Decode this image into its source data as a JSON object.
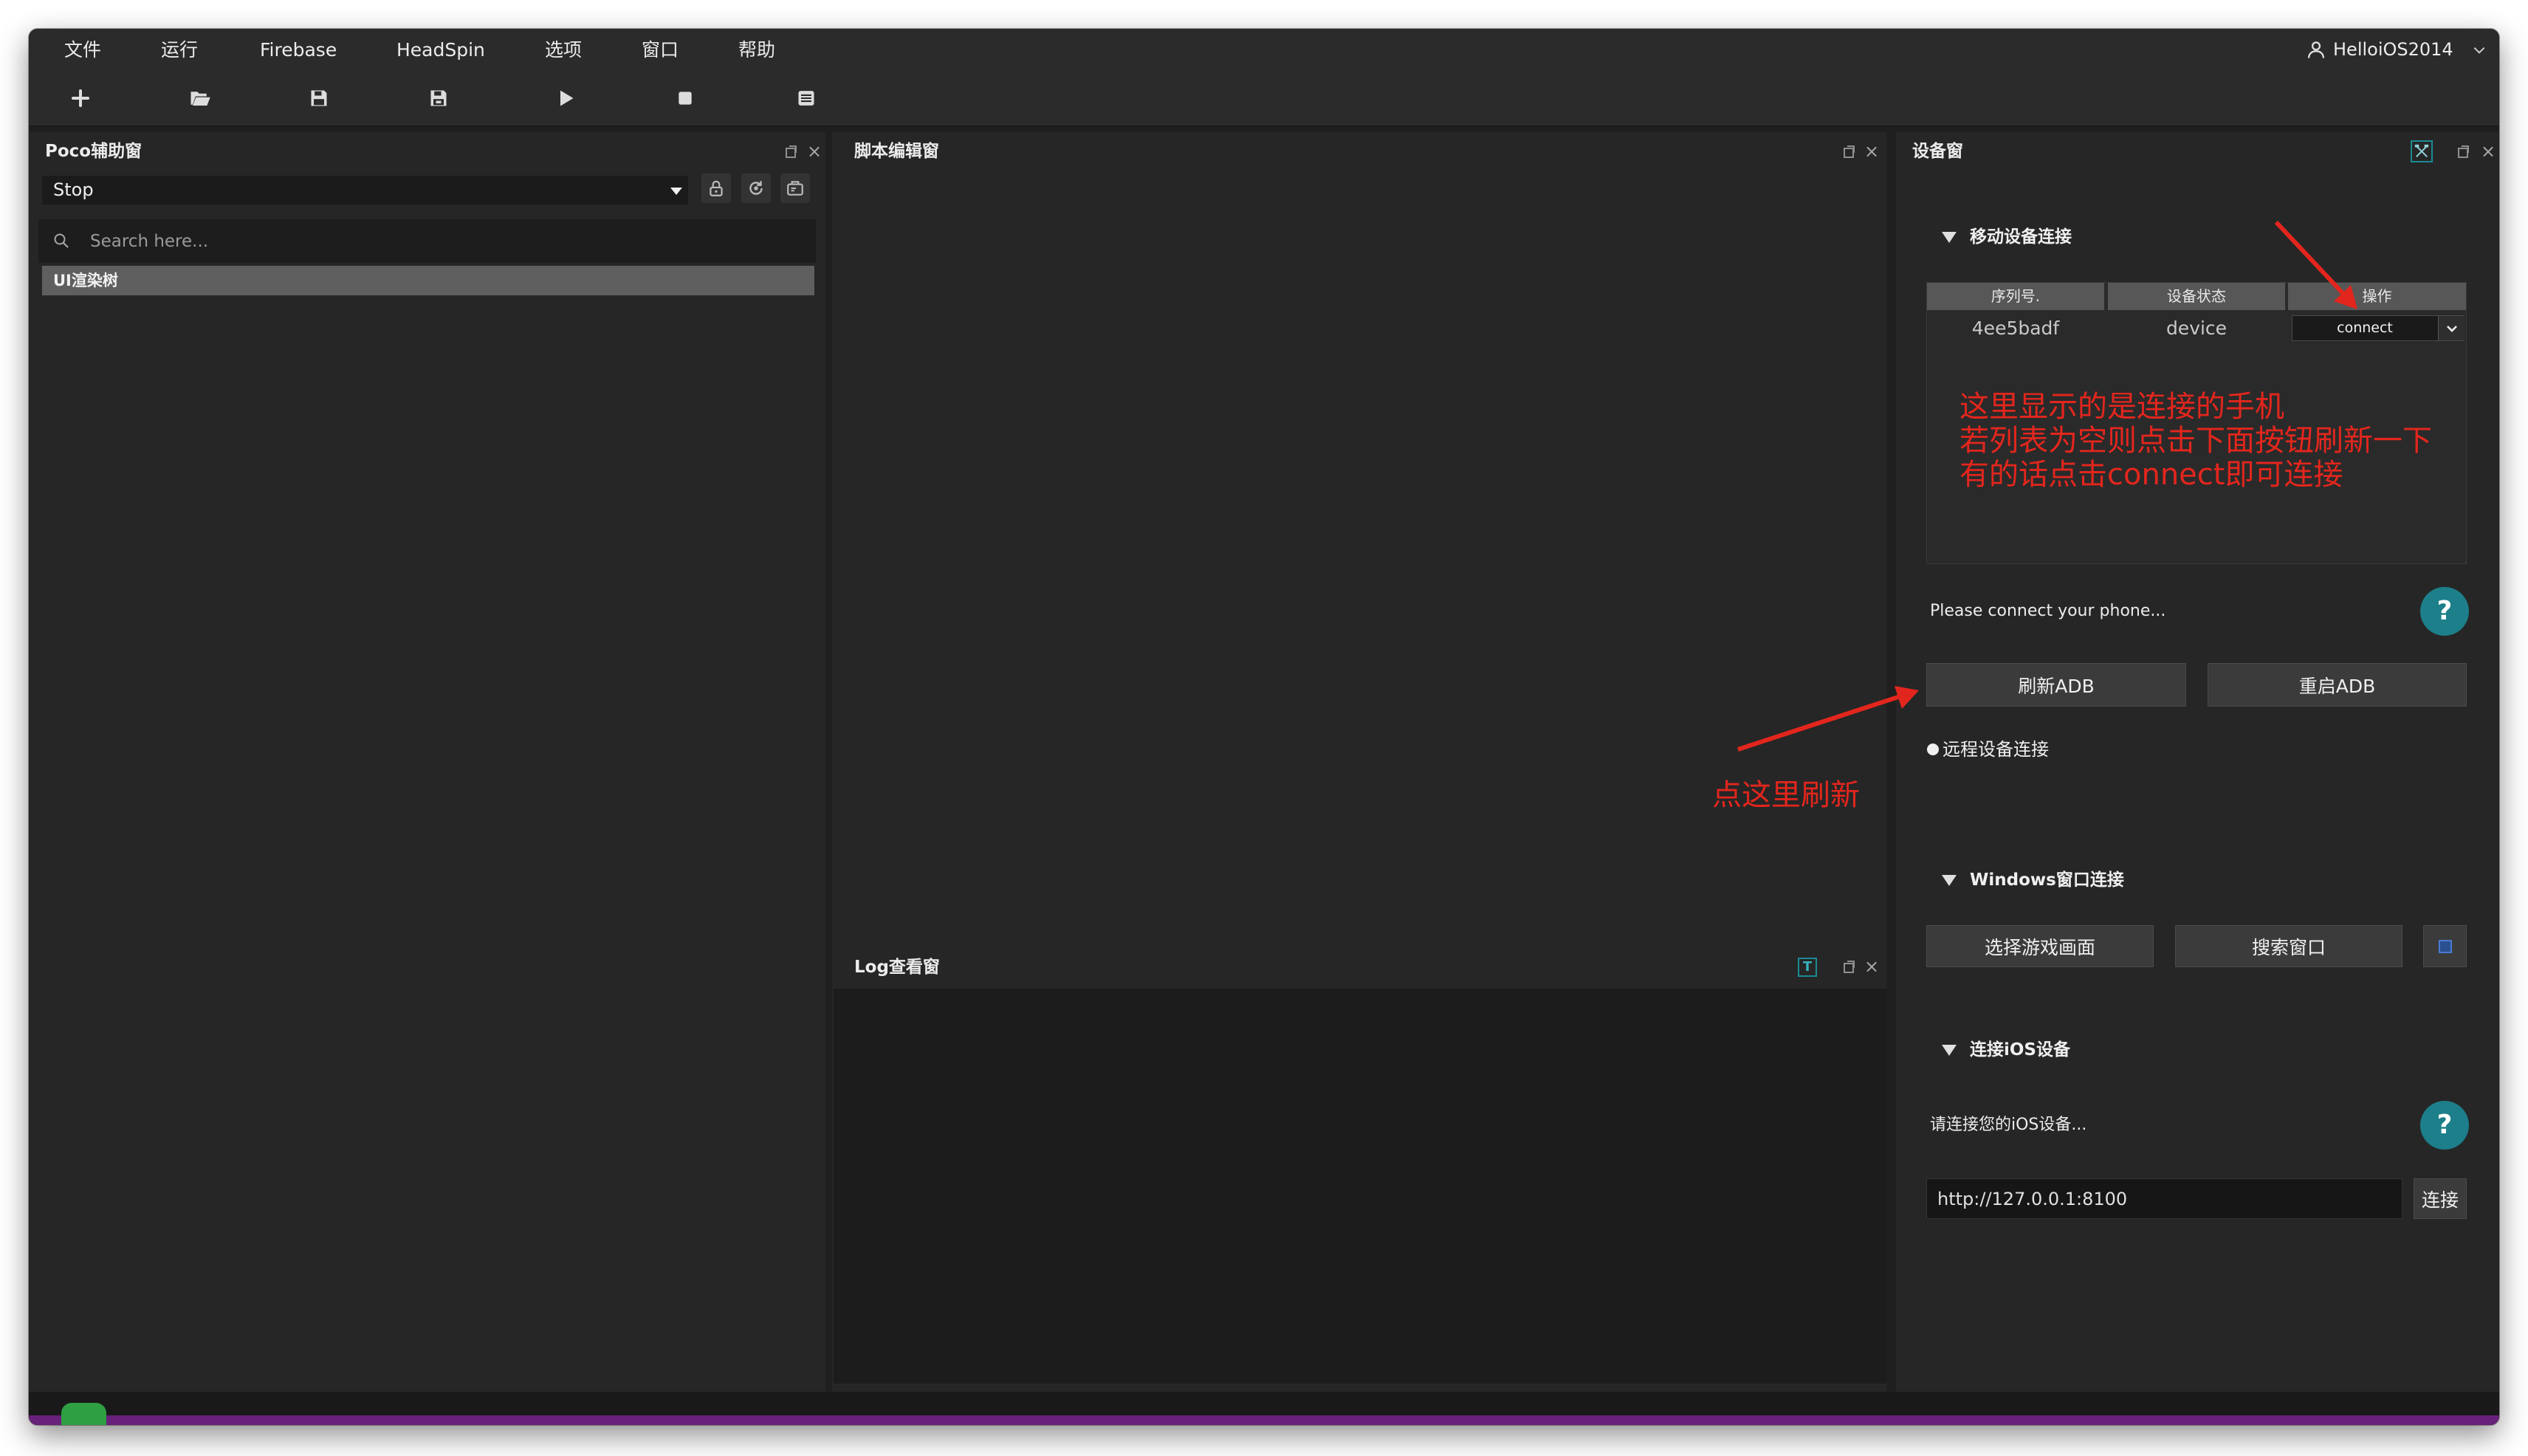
{
  "menu": {
    "items": [
      "文件",
      "运行",
      "Firebase",
      "HeadSpin",
      "选项",
      "窗口",
      "帮助"
    ],
    "user": "HelloiOS2014"
  },
  "toolbar": {
    "icons": [
      "plus-icon",
      "open-folder-icon",
      "save-icon",
      "save-as-icon",
      "play-icon",
      "stop-icon",
      "list-icon"
    ]
  },
  "poco_panel": {
    "title": "Poco辅助窗",
    "mode_select": "Stop",
    "search_placeholder": "Search here...",
    "tree_root": "UI渲染树"
  },
  "script_panel": {
    "title": "脚本编辑窗"
  },
  "log_panel": {
    "title": "Log查看窗",
    "filter_icon_label": "T"
  },
  "device_panel": {
    "title": "设备窗",
    "mobile": {
      "section": "移动设备连接",
      "columns": [
        "序列号.",
        "设备状态",
        "操作"
      ],
      "rows": [
        {
          "serial": "4ee5badf",
          "status": "device",
          "action": "connect"
        }
      ],
      "status_text": "Please connect your phone...",
      "refresh_button": "刷新ADB",
      "restart_button": "重启ADB"
    },
    "remote": {
      "label": "远程设备连接"
    },
    "windows": {
      "section": "Windows窗口连接",
      "select_button": "选择游戏画面",
      "search_button": "搜索窗口"
    },
    "ios": {
      "section": "连接iOS设备",
      "status_text": "请连接您的iOS设备...",
      "url_value": "http://127.0.0.1:8100",
      "connect_button": "连接"
    },
    "help_label": "?"
  },
  "annotations": {
    "table_note": [
      "这里显示的是连接的手机",
      "若列表为空则点击下面按钮刷新一下",
      "有的话点击connect即可连接"
    ],
    "refresh_note": "点这里刷新"
  },
  "colors": {
    "annotation_red": "#e3261d",
    "help_teal": "#1c7f8a",
    "status_purple": "#68217a",
    "panel_bg": "#262626"
  }
}
